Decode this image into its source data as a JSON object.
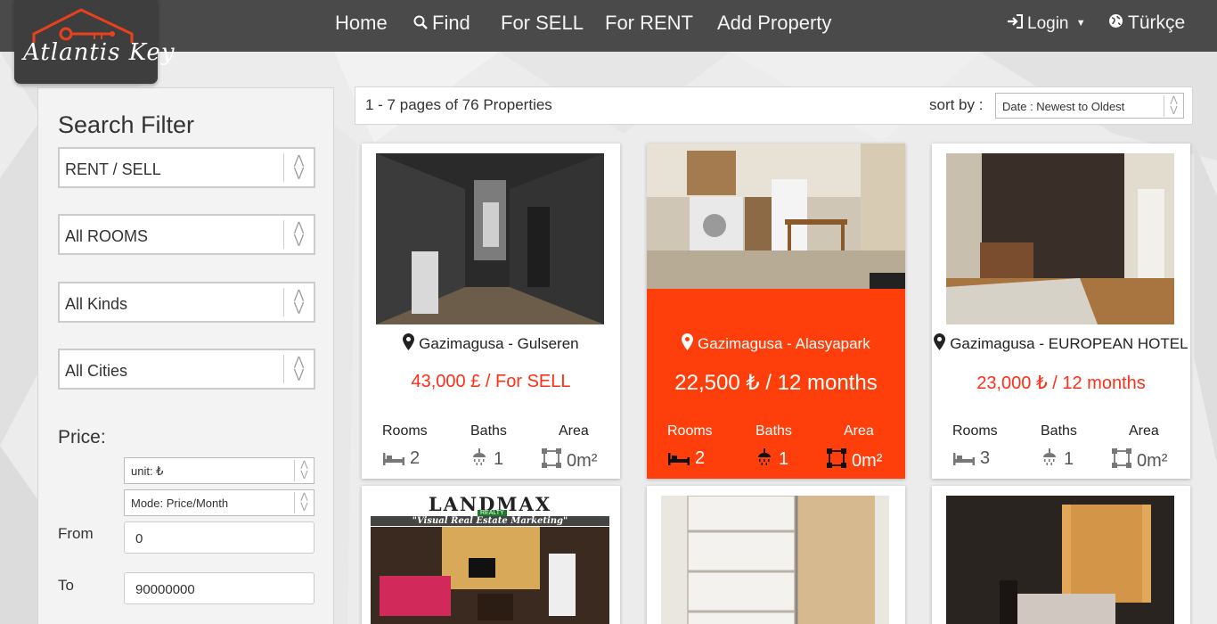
{
  "nav": {
    "logo_text": "Atlantis Key",
    "home": "Home",
    "find": "Find",
    "for_sell": "For SELL",
    "for_rent": "For RENT",
    "add_property": "Add Property",
    "login": "Login",
    "language": "Türkçe"
  },
  "sidebar": {
    "title": "Search Filter",
    "selects": [
      "RENT / SELL",
      "All ROOMS",
      "All Kinds",
      "All Cities"
    ],
    "price_label": "Price:",
    "unit": "unit: ₺",
    "mode": "Mode: Price/Month",
    "from_label": "From",
    "from_value": "0",
    "to_label": "To",
    "to_value": "90000000"
  },
  "results": {
    "summary": "1 - 7 pages of 76 Properties",
    "sort_label": "sort by :",
    "sort_value": "Date : Newest to Oldest"
  },
  "stat_labels": {
    "rooms": "Rooms",
    "baths": "Baths",
    "area": "Area"
  },
  "cards": [
    {
      "location": "Gazimagusa - Gulseren",
      "price": "43,000 £ / For SELL",
      "rooms": "2",
      "baths": "1",
      "area": "0m²"
    },
    {
      "location": "Gazimagusa - Alasyapark",
      "price": "22,500 ₺ / 12 months",
      "rooms": "2",
      "baths": "1",
      "area": "0m²"
    },
    {
      "location": "Gazimagusa - EUROPEAN HOTEL",
      "price": "23,000 ₺ / 12 months",
      "rooms": "3",
      "baths": "1",
      "area": "0m²"
    }
  ],
  "banner": {
    "brand": "LANDMAX",
    "sub": "REALTY",
    "slogan": "\"Visual Real Estate Marketing\""
  },
  "colors": {
    "accent": "#ff3f0b",
    "price": "#ff2f18",
    "navbar": "#4a4a4a"
  }
}
